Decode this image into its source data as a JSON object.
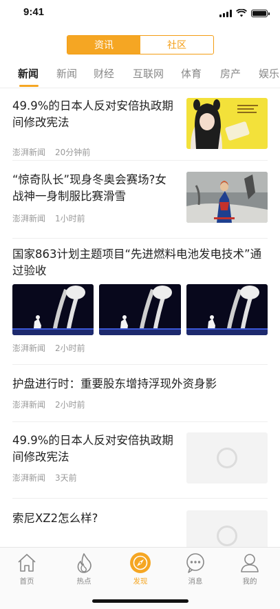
{
  "status": {
    "time": "9:41"
  },
  "segment": {
    "left": "资讯",
    "right": "社区"
  },
  "tabs": [
    "新闻",
    "新闻",
    "财经",
    "互联网",
    "体育",
    "房产",
    "娱乐"
  ],
  "feed": [
    {
      "title": "49.9%的日本人反对安倍执政期间修改宪法",
      "source": "澎湃新闻",
      "time": "20分钟前",
      "thumb": "photo-girl-yellow"
    },
    {
      "title": "“惊奇队长”现身冬奥会赛场?女战神一身制服比赛滑雪",
      "source": "澎湃新闻",
      "time": "1小时前",
      "thumb": "photo-hero"
    },
    {
      "title": "国家863计划主题项目“先进燃料电池发电技术”通过验收",
      "source": "澎湃新闻",
      "time": "2小时前",
      "thumb": "photo-stage-x3"
    },
    {
      "title": "护盘进行时：重要股东增持浮现外资身影",
      "source": "澎湃新闻",
      "time": "2小时前"
    },
    {
      "title": "49.9%的日本人反对安倍执政期间修改宪法",
      "source": "澎湃新闻",
      "time": "3天前",
      "thumb": "image-placeholder"
    },
    {
      "title": "索尼XZ2怎么样?",
      "thumb": "image-placeholder"
    }
  ],
  "nav": [
    {
      "label": "首页",
      "icon": "home-icon"
    },
    {
      "label": "热点",
      "icon": "flame-icon"
    },
    {
      "label": "发现",
      "icon": "compass-icon"
    },
    {
      "label": "消息",
      "icon": "message-icon"
    },
    {
      "label": "我的",
      "icon": "user-icon"
    }
  ],
  "colors": {
    "accent": "#f5a623",
    "active_nav": "#f5a623"
  }
}
